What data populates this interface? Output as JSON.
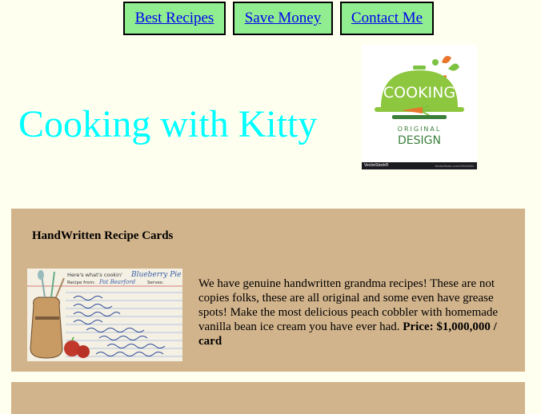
{
  "nav": {
    "items": [
      {
        "label": "Best Recipes"
      },
      {
        "label": "Save Money"
      },
      {
        "label": "Contact Me"
      }
    ]
  },
  "header": {
    "title": "Cooking with Kitty"
  },
  "logo": {
    "word": "COOKING",
    "line1": "ORIGINAL",
    "line2": "DESIGN",
    "footer_left": "VectorStock®",
    "footer_right": "VectorStock.com/29643084"
  },
  "colors": {
    "page_bg": "#fffff0",
    "nav_bg": "#90ee90",
    "title": "#00ffff",
    "card_bg": "#d2b48c",
    "link": "#0000ee"
  },
  "cards": [
    {
      "title": "HandWritten Recipe Cards",
      "image_card": {
        "heading": "Here's what's cookin'",
        "dish": "Blueberry Pie",
        "from_label": "Recipe from:",
        "from": "Pat Bearford",
        "serves_label": "Serves:"
      },
      "description": "We have genuine handwritten grandma recipes! These are not copies folks, these are all original and some even have grease spots! Make the most delicious peach cobbler with homemade vanilla bean ice cream you have ever had.",
      "price_label": "Price: $1,000,000 / card"
    }
  ]
}
